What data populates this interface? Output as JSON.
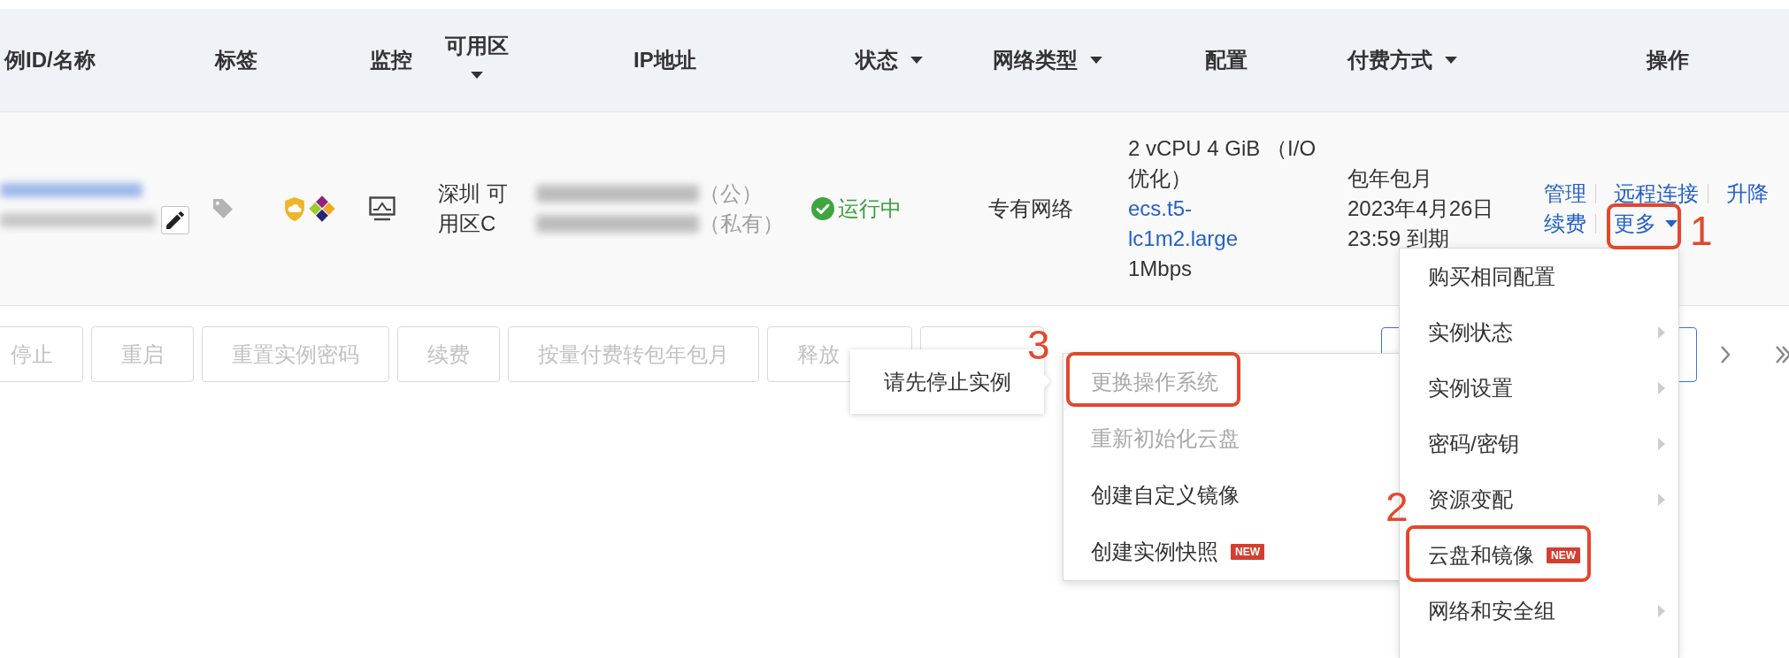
{
  "table": {
    "columns": [
      {
        "label": "例ID/名称",
        "dropdown": false
      },
      {
        "label": "标签",
        "dropdown": false
      },
      {
        "label": "监控",
        "dropdown": false
      },
      {
        "label": "可用区",
        "dropdown": true
      },
      {
        "label": "IP地址",
        "dropdown": false
      },
      {
        "label": "状态",
        "dropdown": true
      },
      {
        "label": "网络类型",
        "dropdown": true
      },
      {
        "label": "配置",
        "dropdown": false
      },
      {
        "label": "付费方式",
        "dropdown": true
      },
      {
        "label": "操作",
        "dropdown": false
      }
    ],
    "rows": [
      {
        "zone": "深圳 可用区C",
        "ip_addresses": [
          {
            "label": "（公）"
          },
          {
            "label": "（私有）"
          }
        ],
        "status": {
          "kind": "running",
          "label": "运行中"
        },
        "network_type": "专有网络",
        "config": {
          "spec": "2 vCPU 4 GiB （I/O优化）",
          "instance_type": "ecs.t5-lc1m2.large",
          "bandwidth": "1Mbps"
        },
        "billing": {
          "type": "包年包月",
          "expiry": "2023年4月26日 23:59 到期"
        },
        "operations": [
          {
            "links": [
              {
                "label": "管理",
                "dropdown": false
              },
              {
                "label": "远程连接",
                "dropdown": false
              },
              {
                "label": "升降",
                "dropdown": false
              }
            ]
          },
          {
            "links": [
              {
                "label": "续费",
                "dropdown": false
              },
              {
                "label": "更多",
                "dropdown": true,
                "annotation": "1"
              }
            ]
          }
        ]
      }
    ]
  },
  "toolbar": {
    "buttons": [
      {
        "kind": "text",
        "label": "停止"
      },
      {
        "kind": "text",
        "label": "重启"
      },
      {
        "kind": "text",
        "label": "重置实例密码"
      },
      {
        "kind": "text",
        "label": "续费"
      },
      {
        "kind": "text",
        "label": "按量付费转包年包月"
      },
      {
        "kind": "text",
        "label": "释放"
      },
      {
        "kind": "covered"
      }
    ]
  },
  "tooltip": {
    "text": "请先停止实例"
  },
  "dropdown_menu": {
    "items": [
      {
        "label": "购买相同配置",
        "submenu": false
      },
      {
        "label": "实例状态",
        "submenu": true
      },
      {
        "label": "实例设置",
        "submenu": true
      },
      {
        "label": "密码/密钥",
        "submenu": true
      },
      {
        "label": "资源变配",
        "submenu": true
      },
      {
        "label": "云盘和镜像",
        "submenu": false,
        "badge": "NEW",
        "annotation": "2"
      },
      {
        "label": "网络和安全组",
        "submenu": true
      }
    ]
  },
  "submenu": {
    "items": [
      {
        "label": "更换操作系统",
        "disabled": true,
        "annotation": "3"
      },
      {
        "label": "重新初始化云盘",
        "disabled": true
      },
      {
        "label": "创建自定义镜像",
        "disabled": false
      },
      {
        "label": "创建实例快照",
        "disabled": false,
        "badge": "NEW"
      }
    ]
  }
}
